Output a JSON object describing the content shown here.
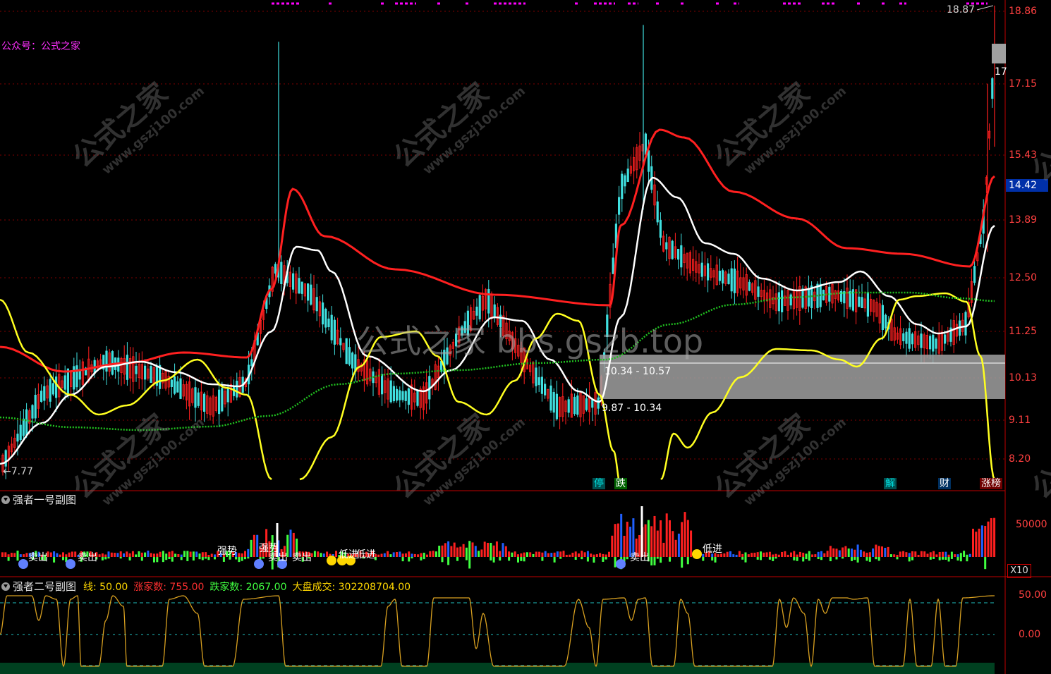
{
  "top_marker_color": "#ff00ff",
  "account_label": "公众号：公式之家",
  "price_axis": [
    "18.86",
    "17.15",
    "15.43",
    "13.89",
    "12.50",
    "11.25",
    "10.13",
    "9.11",
    "8.20"
  ],
  "current_price": "14.42",
  "high_label": "18.87",
  "low_label": "←7.77",
  "price_box_side": "17",
  "zone_upper_label": "10.34 - 10.57",
  "zone_lower_label": "9.87 - 10.34",
  "center_watermark": "公式之家 bbs.gszb.top",
  "watermark_main": "公式之家",
  "watermark_url": "www.gszj100.com",
  "event_tags": [
    {
      "text": "停",
      "color": "#00e0e0",
      "bg": "#005050"
    },
    {
      "text": "跌",
      "color": "#ffffff",
      "bg": "#006000"
    },
    {
      "text": "解",
      "color": "#00e0e0",
      "bg": "#005050"
    },
    {
      "text": "财",
      "color": "#ffffff",
      "bg": "#003060"
    },
    {
      "text": "涨榜",
      "color": "#ffffff",
      "bg": "#700000"
    }
  ],
  "panel1": {
    "title": "强者一号副图",
    "axis_value": "50000",
    "scale_badge": "X10",
    "signals": [
      "卖出",
      "卖出",
      "强势",
      "强势",
      "卖出",
      "卖出",
      "低进",
      "低进",
      "卖出",
      "低进"
    ]
  },
  "panel2": {
    "title": "强者二号副图",
    "fields": [
      {
        "label": "线: 50.00",
        "color": "#ffd700"
      },
      {
        "label": "涨家数: 755.00",
        "color": "#ff3030"
      },
      {
        "label": "跌家数: 2067.00",
        "color": "#40ff40"
      },
      {
        "label": "大盘成交: 302208704.00",
        "color": "#ffd700"
      }
    ],
    "axis": [
      "50.00",
      "0.00"
    ]
  },
  "colors": {
    "up": "#ff2020",
    "down": "#40e0e0",
    "red_line": "#ff2020",
    "white_line": "#ffffff",
    "yellow_line": "#ffff20",
    "green_dots": "#20c020",
    "grid": "#800000"
  }
}
